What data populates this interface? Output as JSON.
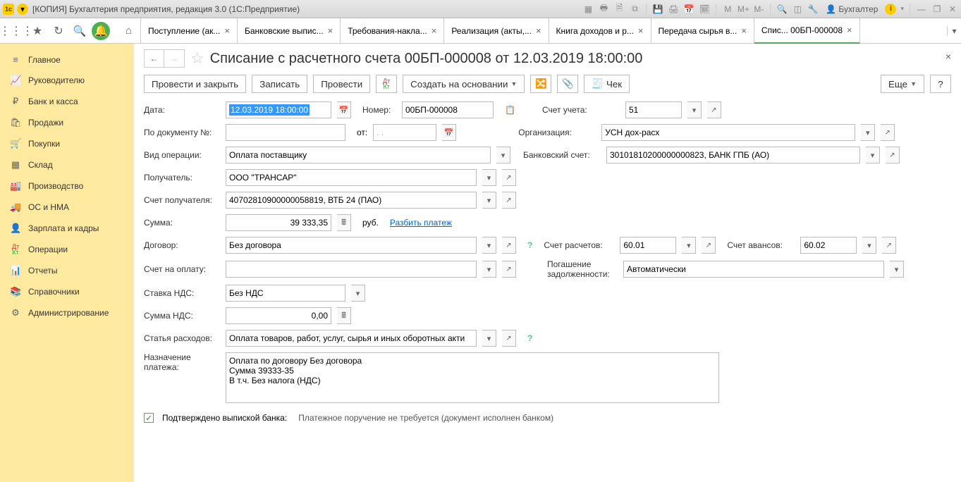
{
  "titlebar": {
    "title": "[КОПИЯ] Бухгалтерия предприятия, редакция 3.0  (1С:Предприятие)",
    "user": "Бухгалтер",
    "m1": "M",
    "m2": "M+",
    "m3": "M-"
  },
  "topnav": {
    "tabs": [
      {
        "label": "Поступление (ак..."
      },
      {
        "label": "Банковские выпис..."
      },
      {
        "label": "Требования-накла..."
      },
      {
        "label": "Реализация (акты,..."
      },
      {
        "label": "Книга доходов и р..."
      },
      {
        "label": "Передача сырья в..."
      },
      {
        "label": "Спис... 00БП-000008"
      }
    ]
  },
  "sidebar": {
    "items": [
      {
        "icon": "≡",
        "label": "Главное"
      },
      {
        "icon": "↗",
        "label": "Руководителю"
      },
      {
        "icon": "₽",
        "label": "Банк и касса"
      },
      {
        "icon": "🛍",
        "label": "Продажи"
      },
      {
        "icon": "🛒",
        "label": "Покупки"
      },
      {
        "icon": "▦",
        "label": "Склад"
      },
      {
        "icon": "🏭",
        "label": "Производство"
      },
      {
        "icon": "🚚",
        "label": "ОС и НМА"
      },
      {
        "icon": "👤",
        "label": "Зарплата и кадры"
      },
      {
        "icon": "Дт",
        "label": "Операции"
      },
      {
        "icon": "📊",
        "label": "Отчеты"
      },
      {
        "icon": "📚",
        "label": "Справочники"
      },
      {
        "icon": "⚙",
        "label": "Администрирование"
      }
    ]
  },
  "doc": {
    "title": "Списание с расчетного счета 00БП-000008 от 12.03.2019 18:00:00"
  },
  "toolbar": {
    "post_close": "Провести и закрыть",
    "save": "Записать",
    "post": "Провести",
    "create_based": "Создать на основании",
    "check": "Чек",
    "more": "Еще"
  },
  "form": {
    "date_lbl": "Дата:",
    "date": "12.03.2019 18:00:00",
    "num_lbl": "Номер:",
    "num": "00БП-000008",
    "acc_lbl": "Счет учета:",
    "acc": "51",
    "docnum_lbl": "По документу №:",
    "docnum": "",
    "ot": "от:",
    "docdate": ". .",
    "org_lbl": "Организация:",
    "org": "УСН дох-расх",
    "optype_lbl": "Вид операции:",
    "optype": "Оплата поставщику",
    "bankacc_lbl": "Банковский счет:",
    "bankacc": "30101810200000000823, БАНК ГПБ (АО)",
    "recipient_lbl": "Получатель:",
    "recipient": "ООО \"ТРАНСАР\"",
    "recacc_lbl": "Счет получателя:",
    "recacc": "40702810900000058819, ВТБ 24 (ПАО)",
    "sum_lbl": "Сумма:",
    "sum": "39 333,35",
    "rub": "руб.",
    "split": "Разбить платеж",
    "contract_lbl": "Договор:",
    "contract": "Без договора",
    "settacc_lbl": "Счет расчетов:",
    "settacc": "60.01",
    "advacc_lbl": "Счет авансов:",
    "advacc": "60.02",
    "invoice_lbl": "Счет на оплату:",
    "invoice": "",
    "debt_lbl": "Погашение задолженности:",
    "debt": "Автоматически",
    "vatrate_lbl": "Ставка НДС:",
    "vatrate": "Без НДС",
    "vatsum_lbl": "Сумма НДС:",
    "vatsum": "0,00",
    "expense_lbl": "Статья расходов:",
    "expense": "Оплата товаров, работ, услуг, сырья и иных оборотных акти",
    "purpose_lbl": "Назначение платежа:",
    "purpose": "Оплата по договору Без договора\nСумма 39333-35\nВ т.ч. Без налога (НДС)",
    "confirmed_lbl": "Подтверждено выпиской банка:",
    "confirmed_text": "Платежное поручение не требуется (документ исполнен банком)"
  }
}
